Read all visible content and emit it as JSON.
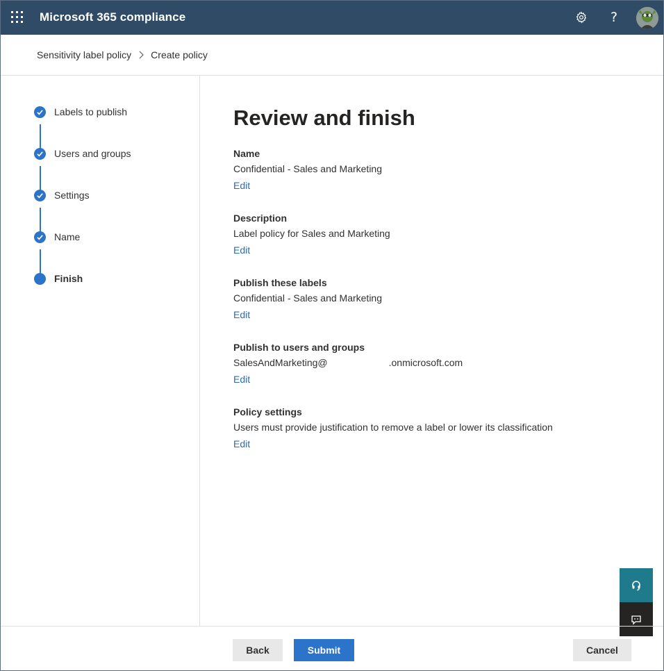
{
  "app": {
    "title": "Microsoft 365 compliance"
  },
  "header_icons": [
    "app-launcher-icon",
    "gear-icon",
    "help-icon",
    "avatar"
  ],
  "breadcrumb": {
    "items": [
      "Sensitivity label policy",
      "Create policy"
    ]
  },
  "steps": [
    {
      "label": "Labels to publish",
      "state": "completed"
    },
    {
      "label": "Users and groups",
      "state": "completed"
    },
    {
      "label": "Settings",
      "state": "completed"
    },
    {
      "label": "Name",
      "state": "completed"
    },
    {
      "label": "Finish",
      "state": "current"
    }
  ],
  "main": {
    "title": "Review and finish",
    "sections": [
      {
        "title": "Name",
        "value": "Confidential - Sales and Marketing",
        "edit": "Edit"
      },
      {
        "title": "Description",
        "value": "Label policy for Sales and Marketing",
        "edit": "Edit"
      },
      {
        "title": "Publish these labels",
        "value": "Confidential - Sales and Marketing",
        "edit": "Edit"
      },
      {
        "title": "Publish to users and groups",
        "value_prefix": "SalesAndMarketing@",
        "value_suffix": ".onmicrosoft.com",
        "edit": "Edit"
      },
      {
        "title": "Policy settings",
        "value": "Users must provide justification to remove a label or lower its classification",
        "edit": "Edit"
      }
    ]
  },
  "footer": {
    "back_label": "Back",
    "submit_label": "Submit",
    "cancel_label": "Cancel"
  },
  "colors": {
    "topbar": "#2f4b66",
    "accent": "#2b74c9",
    "link": "#2b6cb0",
    "support": "#1f7a8c",
    "feedback": "#252423"
  }
}
